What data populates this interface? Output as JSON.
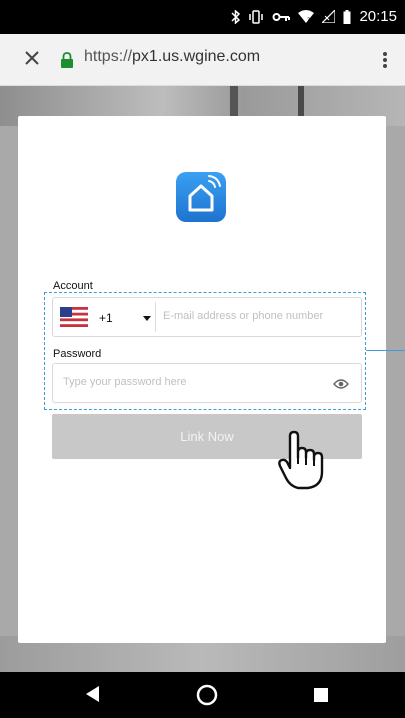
{
  "status_bar": {
    "time": "20:15",
    "icons": [
      "bluetooth-icon",
      "vibrate-icon",
      "vpn-key-icon",
      "wifi-icon",
      "signal-icon",
      "battery-icon"
    ]
  },
  "browser": {
    "url_scheme": "https://",
    "url_host": "px1.us.wgine.com",
    "icons": [
      "close-icon",
      "lock-icon",
      "overflow-menu-icon"
    ]
  },
  "login": {
    "app_icon": "smart-home-icon",
    "account_label": "Account",
    "country_code": "+1",
    "country_flag": "us-flag-icon",
    "account_placeholder": "E-mail address or phone number",
    "password_label": "Password",
    "password_placeholder": "Type your password here",
    "link_button": "Link Now"
  },
  "colors": {
    "accent_dash": "#3a9fd8",
    "app_icon_top": "#3aa0f3",
    "app_icon_bottom": "#1e73cf",
    "button_disabled": "#c8c8c8"
  },
  "nav_bar": {
    "icons": [
      "back-icon",
      "home-icon",
      "recents-icon"
    ]
  }
}
